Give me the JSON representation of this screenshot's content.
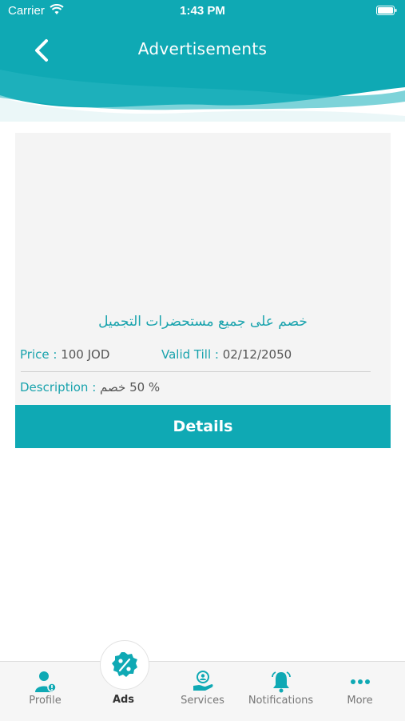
{
  "status_bar": {
    "carrier": "Carrier",
    "time": "1:43 PM"
  },
  "header": {
    "title": "Advertisements",
    "back_icon": "chevron-left-icon"
  },
  "ad": {
    "title": "خصم على جميع مستحضرات التجميل",
    "price_label": "Price : ",
    "price_value": "100 JOD",
    "valid_label": "Valid Till : ",
    "valid_value": "02/12/2050",
    "description_label": "Description : ",
    "description_value": "% 50 خصم",
    "details_label": "Details"
  },
  "tabs": [
    {
      "label": "Profile",
      "icon": "profile-icon"
    },
    {
      "label": "Ads",
      "icon": "percent-badge-icon",
      "active": true
    },
    {
      "label": "Services",
      "icon": "services-icon"
    },
    {
      "label": "Notifications",
      "icon": "bell-icon"
    },
    {
      "label": "More",
      "icon": "more-dots-icon"
    }
  ],
  "colors": {
    "primary": "#0fa9b4",
    "text_accent": "#19a3ad",
    "card_bg": "#f4f4f4"
  }
}
